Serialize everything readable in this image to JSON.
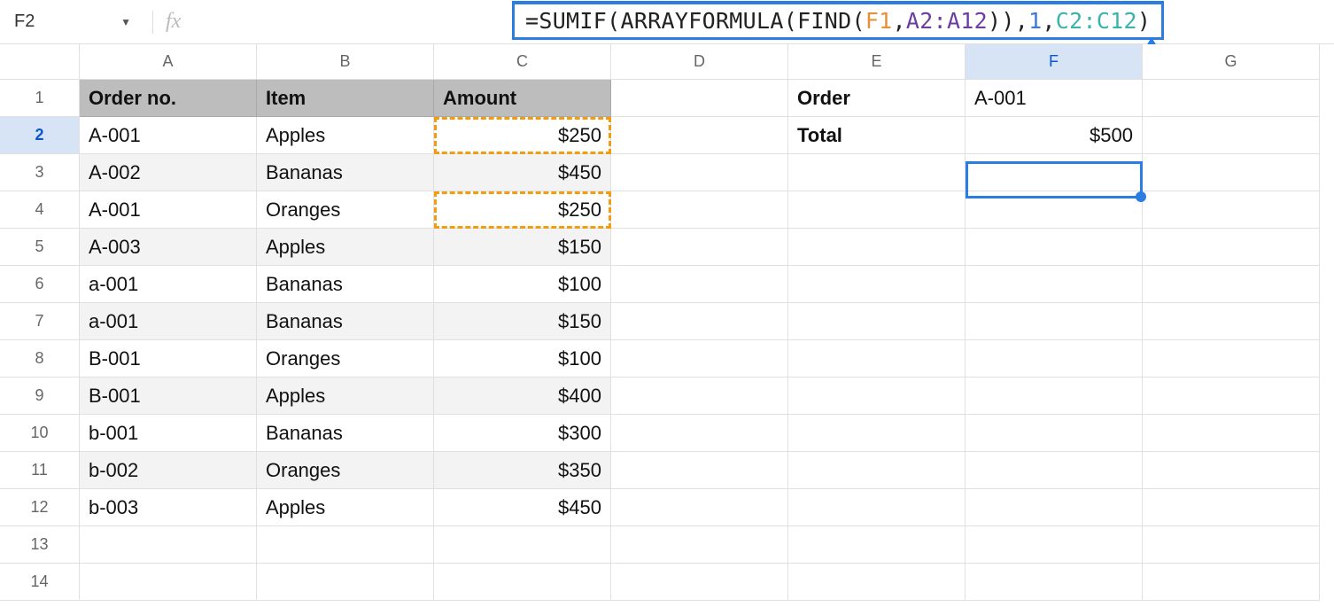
{
  "nameBox": {
    "value": "F2",
    "dropdownGlyph": "▼"
  },
  "fx": {
    "glyph": "fx"
  },
  "formula": {
    "eq": "=",
    "fn1": "SUMIF",
    "op1": "(",
    "fn2": "ARRAYFORMULA",
    "op2": "(",
    "fn3": "FIND",
    "op3": "(",
    "arg1": "F1",
    "c1": ", ",
    "arg2": "A2:A12",
    "op4": ")),",
    "arg3": "1",
    "c2": ", ",
    "arg4": "C2:C12",
    "op5": ")"
  },
  "columns": [
    "A",
    "B",
    "C",
    "D",
    "E",
    "F",
    "G"
  ],
  "rows": [
    "1",
    "2",
    "3",
    "4",
    "5",
    "6",
    "7",
    "8",
    "9",
    "10",
    "11",
    "12",
    "13",
    "14"
  ],
  "headers": {
    "A": "Order no.",
    "B": "Item",
    "C": "Amount"
  },
  "side": {
    "E1": "Order",
    "F1": "A-001",
    "E2": "Total",
    "F2": "$500"
  },
  "data": [
    {
      "order": "A-001",
      "item": "Apples",
      "amount": "$250"
    },
    {
      "order": "A-002",
      "item": "Bananas",
      "amount": "$450"
    },
    {
      "order": "A-001",
      "item": "Oranges",
      "amount": "$250"
    },
    {
      "order": "A-003",
      "item": "Apples",
      "amount": "$150"
    },
    {
      "order": "a-001",
      "item": "Bananas",
      "amount": "$100"
    },
    {
      "order": "a-001",
      "item": "Bananas",
      "amount": "$150"
    },
    {
      "order": "B-001",
      "item": "Oranges",
      "amount": "$100"
    },
    {
      "order": "B-001",
      "item": "Apples",
      "amount": "$400"
    },
    {
      "order": "b-001",
      "item": "Bananas",
      "amount": "$300"
    },
    {
      "order": "b-002",
      "item": "Oranges",
      "amount": "$350"
    },
    {
      "order": "b-003",
      "item": "Apples",
      "amount": "$450"
    }
  ],
  "highlightedAmountRows": [
    0,
    2
  ],
  "shadedDataRows": [
    1,
    3,
    5,
    7,
    9
  ],
  "activeCell": "F2"
}
